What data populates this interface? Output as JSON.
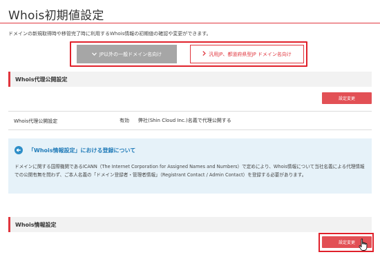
{
  "page": {
    "title": "Whois初期値設定",
    "intro": "ドメインの新規取得時や移管完了時に利用するWhois情報の初期値の確認や変更ができます。"
  },
  "tabs": [
    {
      "label": "JP以外の一般ドメイン名向け",
      "icon": "chevron-down-icon"
    },
    {
      "label": "汎用JP、都道府県型JP ドメイン名向け",
      "icon": "chevron-right-icon"
    }
  ],
  "proxy_section": {
    "heading": "Whois代理公開設定",
    "button_label": "設定変更",
    "row": {
      "label": "Whois代理公開設定",
      "status": "有効",
      "description": "弊社(Shin Cloud Inc.)名義で代理公開する"
    }
  },
  "info_box": {
    "icon": "megaphone-icon",
    "title": "「Whois情報設定」における登録について",
    "body": "ドメインに関する国際機関であるICANN（The Internet Corporation for Assigned Names and Numbers）で定めにより、Whois情報について当社名義による代理情報での公開有無を問わず、ご本人名義の「ドメイン登録者・管理者情報」（Registrant Contact / Admin Contact）を登録する必要があります。"
  },
  "whois_section": {
    "heading": "Whois情報設定",
    "button_label": "設定変更"
  },
  "colors": {
    "accent": "#e0353d",
    "button": "#e25055",
    "info_bg": "#e6f2f9",
    "info_title": "#1f7ab8"
  }
}
